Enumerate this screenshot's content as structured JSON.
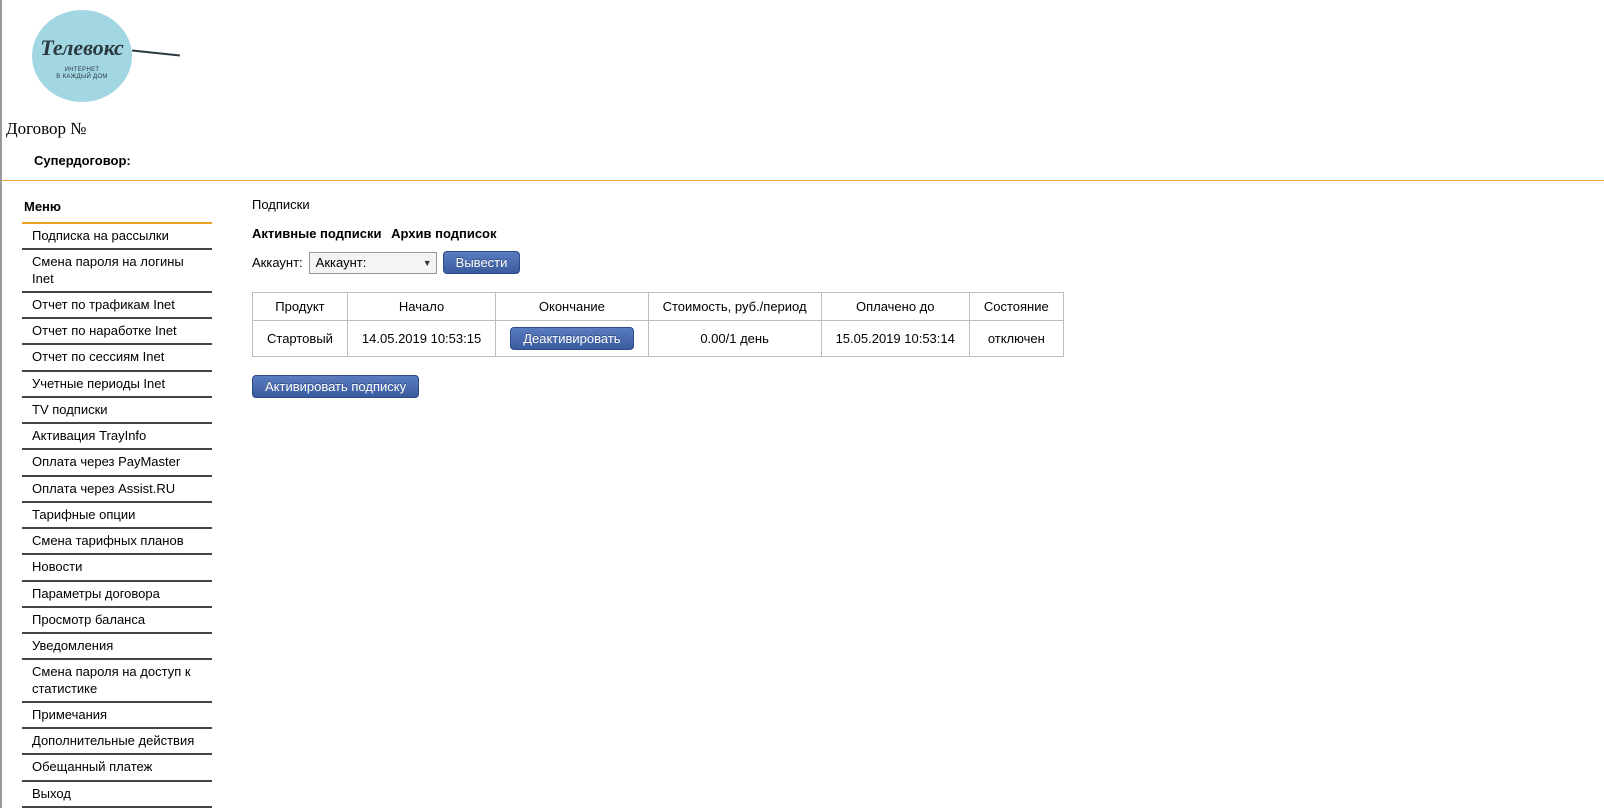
{
  "logo": {
    "brand": "Телевокс",
    "tagline1": "ИНТЕРНЕТ",
    "tagline2": "В КАЖДЫЙ ДОМ"
  },
  "header": {
    "contract_label": "Договор №",
    "super_label": "Супердоговор:"
  },
  "menu": {
    "title": "Меню",
    "items": [
      "Подписка на рассылки",
      "Смена пароля на логины Inet",
      "Отчет по трафикам Inet",
      "Отчет по наработке Inet",
      "Отчет по сессиям Inet",
      "Учетные периоды Inet",
      "TV подписки",
      "Активация TrayInfo",
      "Оплата через PayMaster",
      "Оплата через Assist.RU",
      "Тарифные опции",
      "Смена тарифных планов",
      "Новости",
      "Параметры договора",
      "Просмотр баланса",
      "Уведомления",
      "Смена пароля на доступ к статистике",
      "Примечания",
      "Дополнительные действия",
      "Обещанный платеж",
      "Выход"
    ]
  },
  "content": {
    "title": "Подписки",
    "tabs": {
      "active": "Активные подписки",
      "archive": "Архив подписок"
    },
    "filter": {
      "label": "Аккаунт:",
      "select_display": "Аккаунт:",
      "submit": "Вывести"
    },
    "table": {
      "headers": [
        "Продукт",
        "Начало",
        "Окончание",
        "Стоимость, руб./период",
        "Оплачено до",
        "Состояние"
      ],
      "row": {
        "product": "Стартовый",
        "start": "14.05.2019 10:53:15",
        "end_action": "Деактивировать",
        "cost": "0.00/1 день",
        "paid_until": "15.05.2019 10:53:14",
        "state": "отключен"
      }
    },
    "activate_button": "Активировать подписку"
  }
}
